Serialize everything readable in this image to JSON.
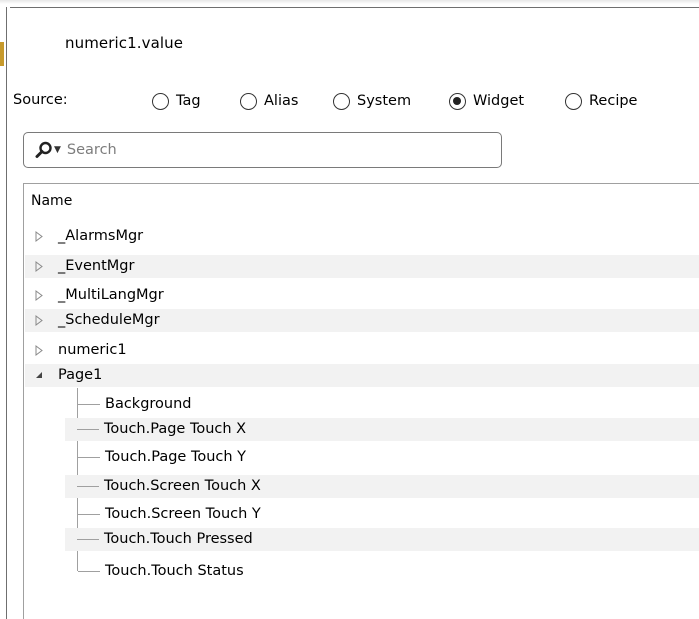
{
  "dialog": {
    "title": "numeric1.value"
  },
  "source": {
    "label": "Source:",
    "options": [
      {
        "label": "Tag",
        "checked": false
      },
      {
        "label": "Alias",
        "checked": false
      },
      {
        "label": "System",
        "checked": false
      },
      {
        "label": "Widget",
        "checked": true
      },
      {
        "label": "Recipe",
        "checked": false
      }
    ]
  },
  "search": {
    "placeholder": "Search",
    "value": ""
  },
  "tree": {
    "header": "Name",
    "nodes": [
      {
        "label": "_AlarmsMgr",
        "state": "collapsed"
      },
      {
        "label": "_EventMgr",
        "state": "collapsed"
      },
      {
        "label": "_MultiLangMgr",
        "state": "collapsed"
      },
      {
        "label": "_ScheduleMgr",
        "state": "collapsed"
      },
      {
        "label": "numeric1",
        "state": "collapsed"
      },
      {
        "label": "Page1",
        "state": "expanded",
        "children": [
          "Background",
          "Touch.Page Touch X",
          "Touch.Page Touch Y",
          "Touch.Screen Touch X",
          "Touch.Screen Touch Y",
          "Touch.Touch Pressed",
          "Touch.Touch Status"
        ]
      }
    ]
  },
  "icons": {
    "search": "search-icon",
    "dropdown": "chevron-down-icon",
    "collapsed": "triangle-right-icon",
    "expanded": "triangle-down-icon"
  },
  "colors": {
    "alt_row": "#f2f2f2",
    "tree_line": "#a0a0a0",
    "placeholder": "#7d7d7d"
  }
}
